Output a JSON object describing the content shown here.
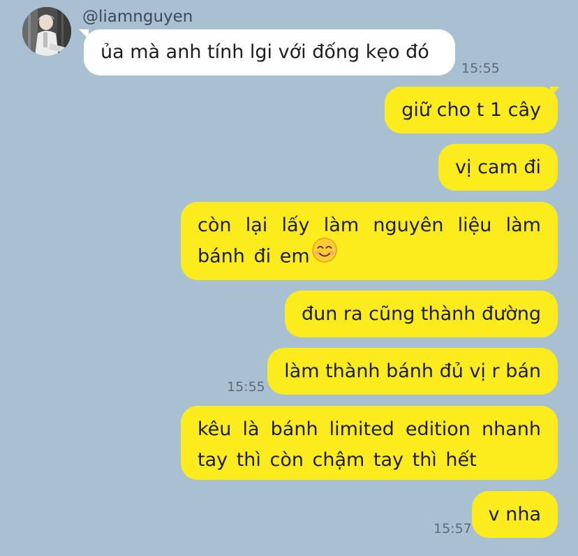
{
  "incoming": {
    "username": "@liamnguyen",
    "message": "ủa mà anh tính lgi với đống kẹo đó",
    "time": "15:55"
  },
  "outgoing": [
    {
      "text": "giữ cho t 1 cây"
    },
    {
      "text": "vị cam đi"
    },
    {
      "text": "còn lại lấy làm nguyên liệu làm bánh đi em",
      "emoji": "smiling-face-with-smiling-eyes"
    },
    {
      "text": "đun ra cũng thành đường"
    },
    {
      "text": "làm thành bánh đủ vị r bán",
      "time": "15:55"
    },
    {
      "text": "kêu là bánh limited edition nhanh tay thì còn chậm tay thì hết"
    },
    {
      "text": "v nha",
      "time": "15:57"
    }
  ],
  "colors": {
    "background": "#a9c0d3",
    "incoming_bubble": "#ffffff",
    "outgoing_bubble": "#fcec1e",
    "timestamp": "#5d6a76"
  }
}
